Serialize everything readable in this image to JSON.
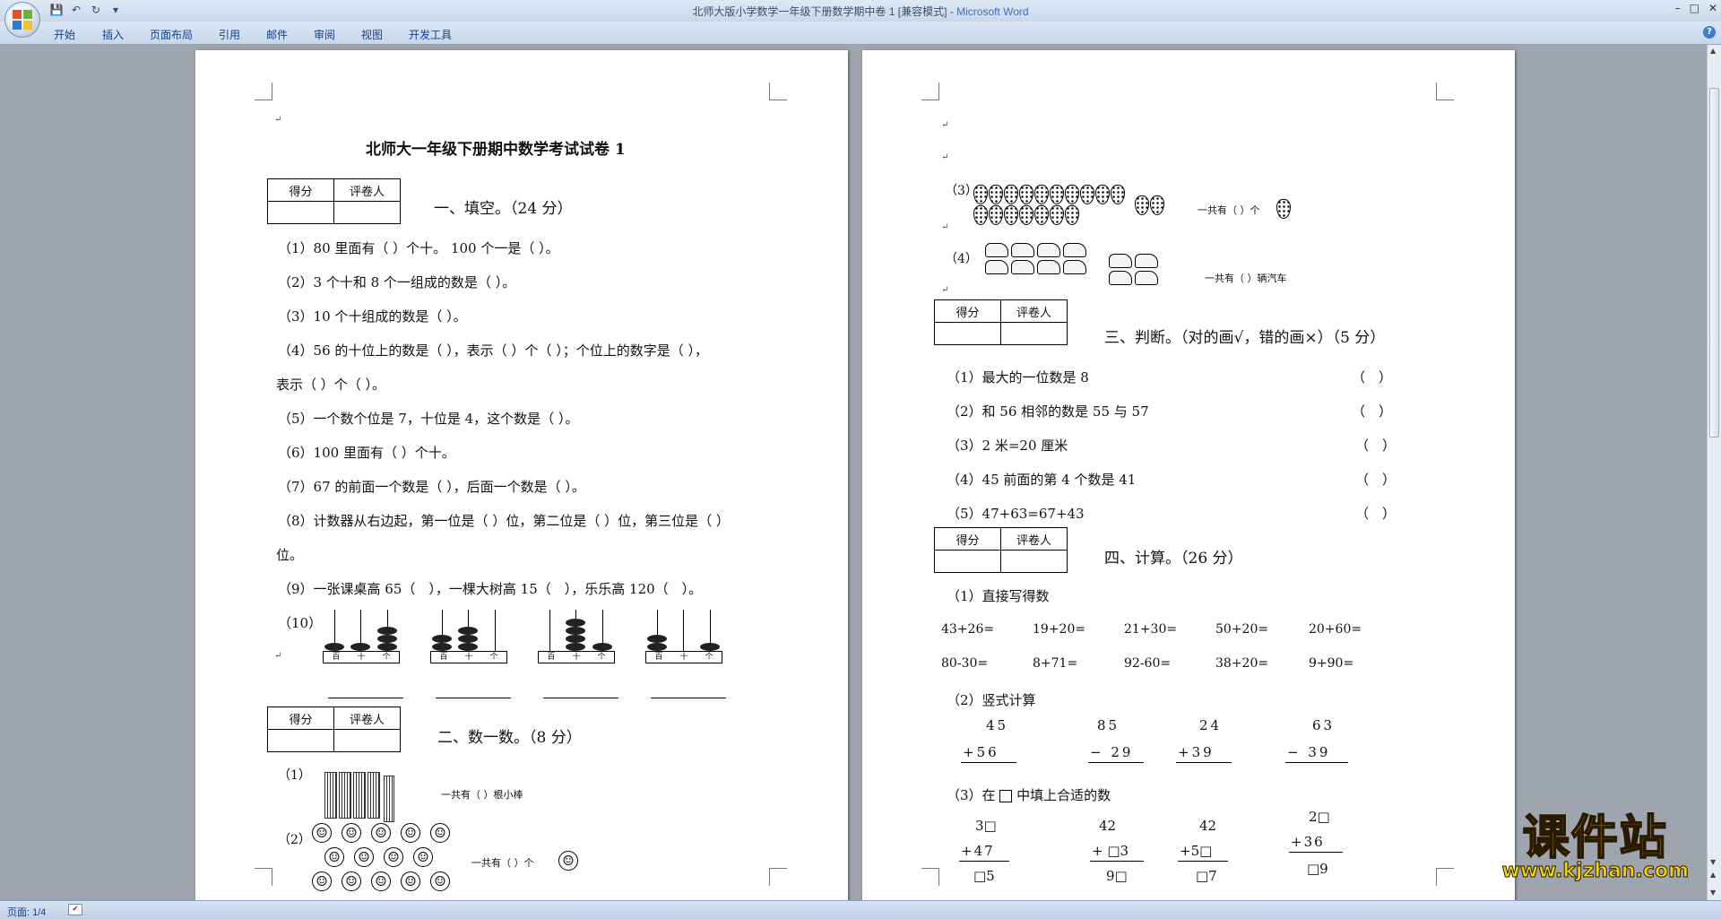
{
  "window": {
    "title_doc": "北师大版小学数学一年级下册数学期中卷 1 [兼容模式] - ",
    "title_app": "Microsoft Word",
    "minimize": "–",
    "maximize": "□",
    "close": "✕"
  },
  "qat": {
    "save": "💾",
    "undo": "↶",
    "redo": "↻",
    "more": "▾"
  },
  "ribbon": {
    "tabs": [
      "开始",
      "插入",
      "页面布局",
      "引用",
      "邮件",
      "审阅",
      "视图",
      "开发工具"
    ],
    "help": "?"
  },
  "status": {
    "page": "页面: 1/4",
    "lang_icon": "✔"
  },
  "watermark": {
    "title": "课件站",
    "url": "www.kjzhan.com"
  },
  "page1": {
    "title": "北师大一年级下册期中数学考试试卷 1",
    "score_headers": [
      "得分",
      "评卷人"
    ],
    "sec1": "一、填空。（24 分）",
    "q1": "（1）80 里面有（ ）个十。 100 个一是（ ）。",
    "q2": "（2）3 个十和 8 个一组成的数是（ ）。",
    "q3": "（3）10 个十组成的数是（ ）。",
    "q4a": "（4）56 的十位上的数是（ ），表示（ ）个（ ）；个位上的数字是（ ），",
    "q4b": "表示（ ）个（ ）。",
    "q5": "（5）一个数个位是 7，十位是 4，这个数是（ ）。",
    "q6": "（6）100 里面有（ ）个十。",
    "q7": "（7）67 的前面一个数是（ ），后面一个数是（ ）。",
    "q8a": "（8）计数器从右边起，第一位是（ ）位，第二位是（ ）位，第三位是（ ）",
    "q8b": "位。",
    "q9": "（9）一张课桌高 65（　），一棵大树高 15（　），乐乐高 120（　）。",
    "q10": "（10）",
    "abacus_labels": [
      "百",
      "十",
      "个"
    ],
    "sec2": "二、数一数。（8 分）",
    "c1_label": "（1）",
    "c1_text": "一共有（ ）根小棒",
    "c2_label": "（2）",
    "c2_text": "一共有（ ）个"
  },
  "page2": {
    "c3_label": "（3）",
    "c3_text": "一共有（ ）个",
    "c4_label": "（4）",
    "c4_text": "一共有（ ）辆汽车",
    "sec3": "三、判断。（对的画√，错的画×）（5 分）",
    "judge": [
      {
        "q": "（1）最大的一位数是 8",
        "a": "（　）"
      },
      {
        "q": "（2）和 56 相邻的数是 55 与 57",
        "a": "（　）"
      },
      {
        "q": "（3）2 米=20 厘米",
        "a": "（　）"
      },
      {
        "q": "（4）45 前面的第 4 个数是 41",
        "a": "（　）"
      },
      {
        "q": "（5）47+63=67+43",
        "a": "（　）"
      }
    ],
    "sec4": "四、计算。（26 分）",
    "calc1_label": "（1）直接写得数",
    "row1": [
      "43+26=",
      "19+20=",
      "21+30=",
      "50+20=",
      "20+60="
    ],
    "row2": [
      "80-30=",
      "8+71=",
      "92-60=",
      "38+20=",
      "9+90="
    ],
    "calc2_label": "（2）竖式计算",
    "vert": [
      {
        "top": "45",
        "bot": "+56"
      },
      {
        "top": "85",
        "bot": "− 29"
      },
      {
        "top": "24",
        "bot": "+39"
      },
      {
        "top": "63",
        "bot": "− 39"
      }
    ],
    "calc3_label_a": "（3）在",
    "calc3_label_b": "中填上合适的数",
    "fill": [
      {
        "top": "3□",
        "mid": "+47",
        "res": "□5"
      },
      {
        "top": "42",
        "mid": "+ □3",
        "res": "9□"
      },
      {
        "top": "42",
        "mid": "+5□",
        "res": "□7"
      },
      {
        "top": "2□",
        "mid": "+36",
        "res": "□9"
      }
    ]
  }
}
